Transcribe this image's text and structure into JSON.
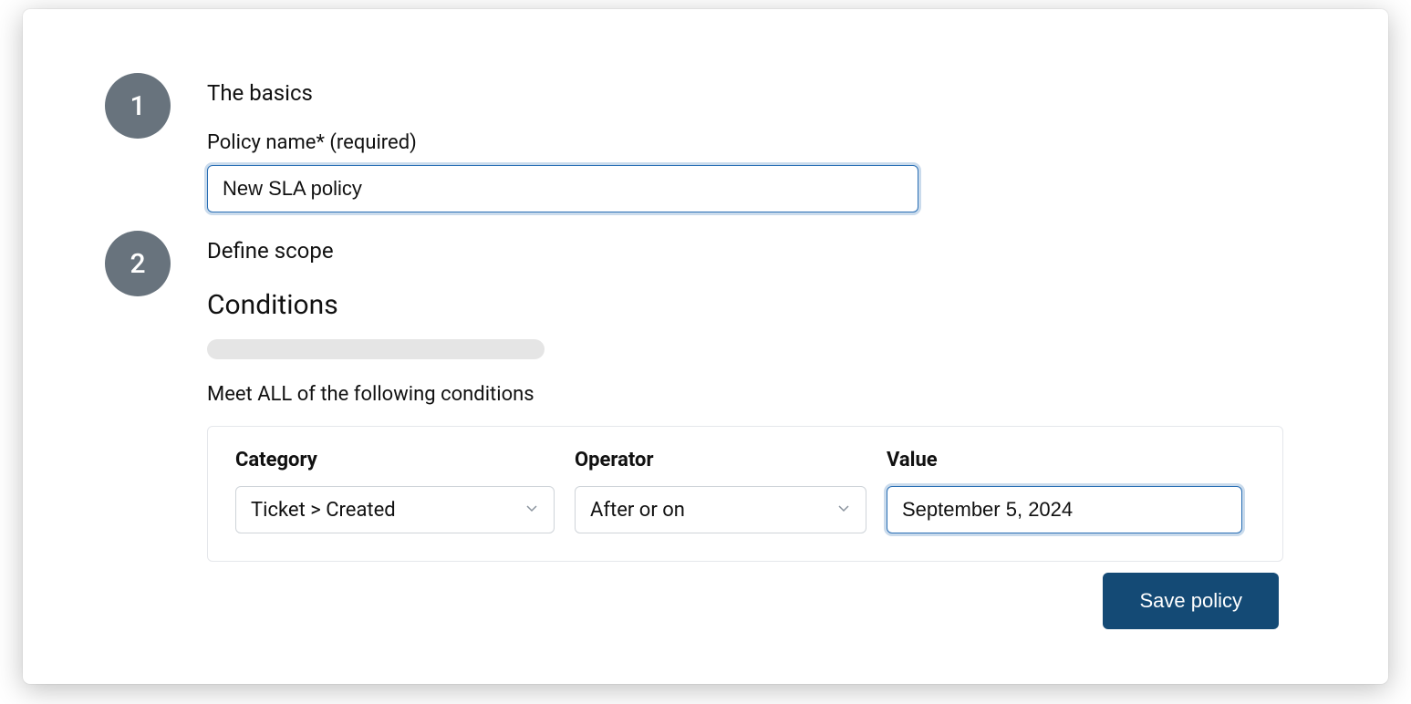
{
  "steps": {
    "basics": {
      "number": "1",
      "title": "The basics",
      "policy_name_label": "Policy name* (required)",
      "policy_name_value": "New SLA policy"
    },
    "scope": {
      "number": "2",
      "title": "Define scope",
      "conditions_heading": "Conditions",
      "all_conditions_label": "Meet ALL of the following conditions",
      "columns": {
        "category": "Category",
        "operator": "Operator",
        "value": "Value"
      },
      "row": {
        "category": "Ticket > Created",
        "operator": "After or on",
        "value": "September 5, 2024"
      }
    }
  },
  "buttons": {
    "save": "Save policy"
  }
}
